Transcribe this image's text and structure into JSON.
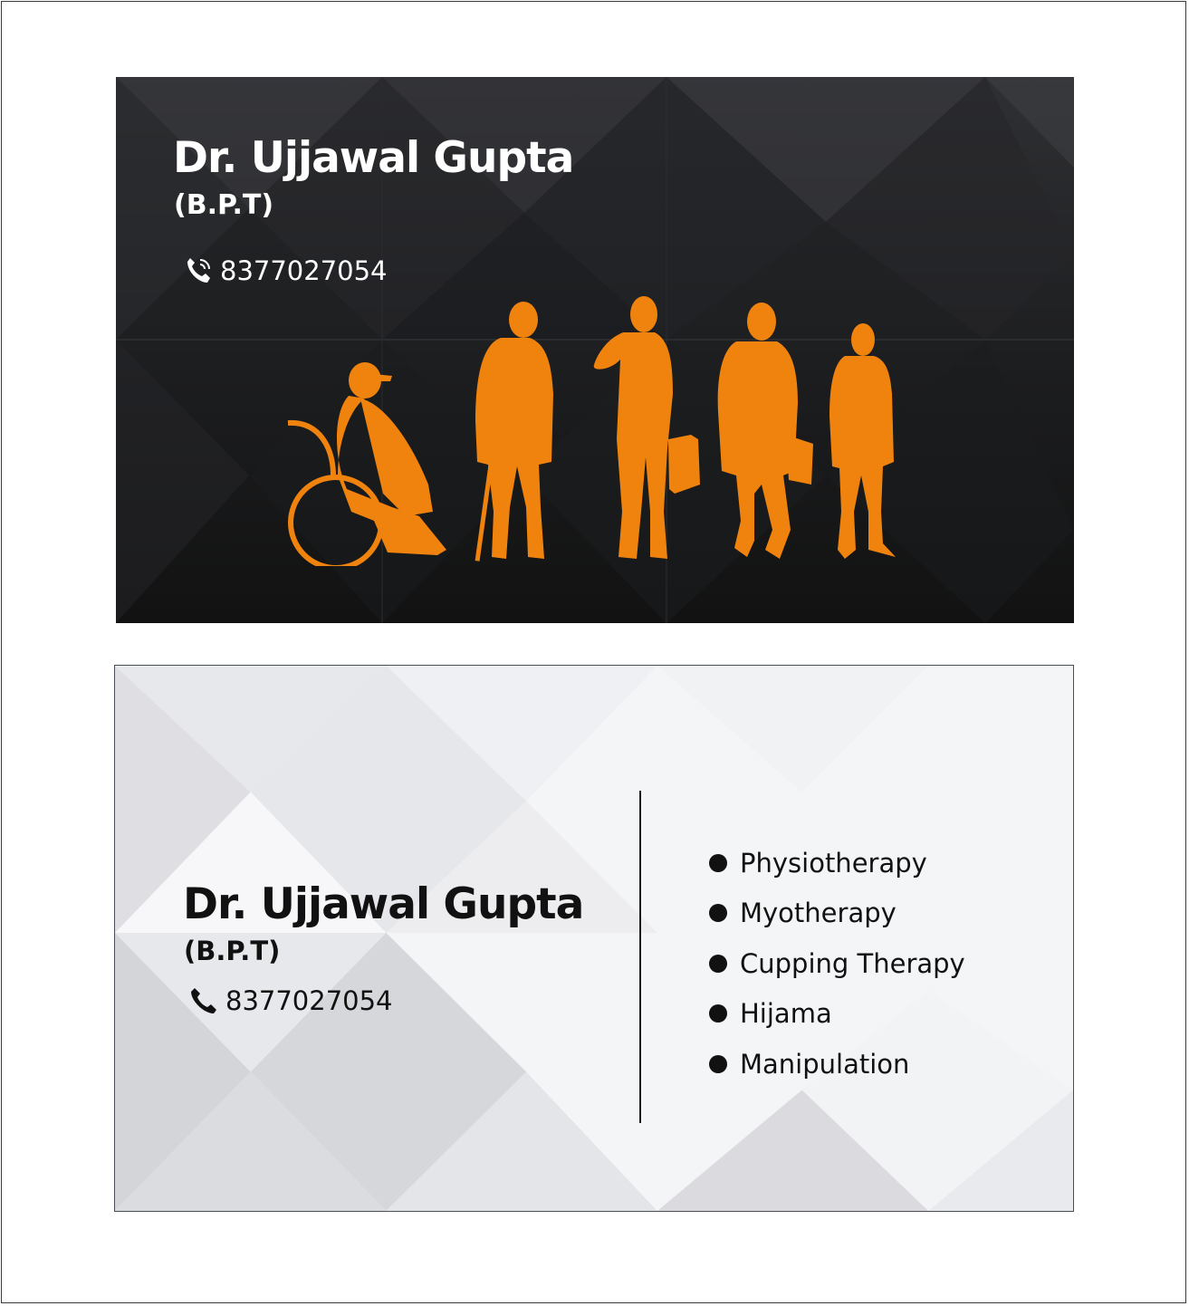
{
  "front": {
    "name": "Dr. Ujjawal Gupta",
    "degree": "(B.P.T)",
    "phone": "8377027054",
    "phone_icon": "phone-icon",
    "illustration": "people-silhouettes",
    "accent_color": "#f0830e",
    "background_color": "#1c1d1f"
  },
  "back": {
    "name": "Dr. Ujjawal Gupta",
    "degree": "(B.P.T)",
    "phone": "8377027054",
    "phone_icon": "phone-icon",
    "background_color": "#f4f5f7",
    "services": [
      "Physiotherapy",
      "Myotherapy",
      "Cupping Therapy",
      "Hijama",
      "Manipulation"
    ]
  }
}
